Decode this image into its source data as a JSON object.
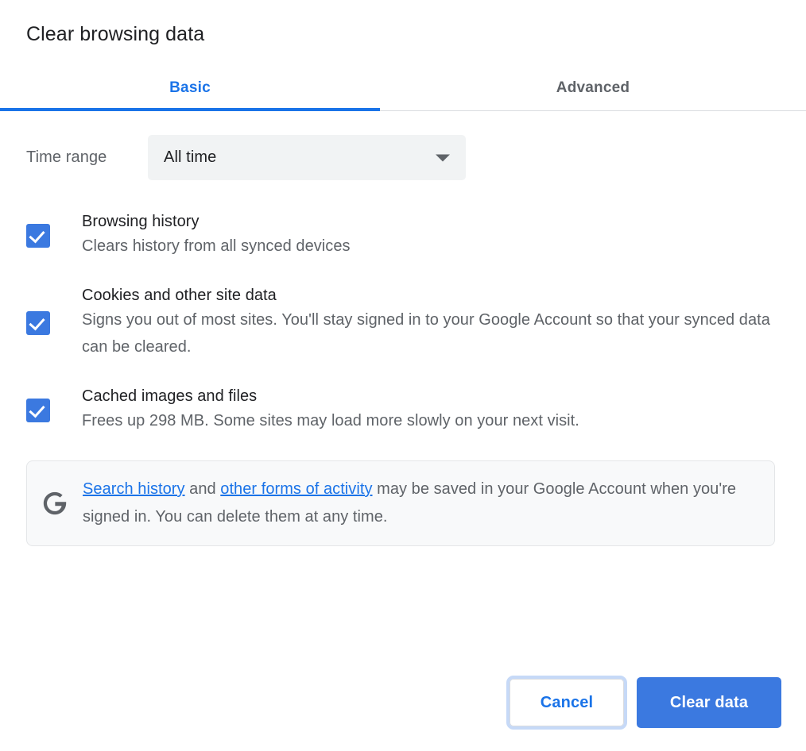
{
  "dialog": {
    "title": "Clear browsing data"
  },
  "tabs": [
    {
      "id": "basic",
      "label": "Basic",
      "selected": true
    },
    {
      "id": "advanced",
      "label": "Advanced",
      "selected": false
    }
  ],
  "time_range": {
    "label": "Time range",
    "selected_value": "All time",
    "arrow_icon": "chevron-down-icon"
  },
  "options": [
    {
      "id": "browsing-history",
      "title": "Browsing history",
      "description": "Clears history from all synced devices",
      "checked": true
    },
    {
      "id": "cookies-and-site-data",
      "title": "Cookies and other site data",
      "description": "Signs you out of most sites. You'll stay signed in to your Google Account so that your synced data can be cleared.",
      "checked": true
    },
    {
      "id": "cached-images-and-files",
      "title": "Cached images and files",
      "description": "Frees up 298 MB. Some sites may load more slowly on your next visit.",
      "checked": true
    }
  ],
  "info_box": {
    "icon": "google-g-icon",
    "link1": "Search history",
    "middle": " and ",
    "link2": "other forms of activity",
    "rest": " may be saved in your Google Account when you're signed in. You can delete them at any time."
  },
  "footer": {
    "cancel_label": "Cancel",
    "confirm_label": "Clear data"
  },
  "colors": {
    "accent_blue": "#1a73e8",
    "button_blue": "#3b79e0",
    "checkbox_blue": "#3b79e0",
    "text_primary": "#202124",
    "text_secondary": "#5f6368",
    "surface_grey": "#f1f3f4",
    "info_bg": "#f8f9fa",
    "border_grey": "#dadce0",
    "focus_ring": "#c6d9f7"
  }
}
